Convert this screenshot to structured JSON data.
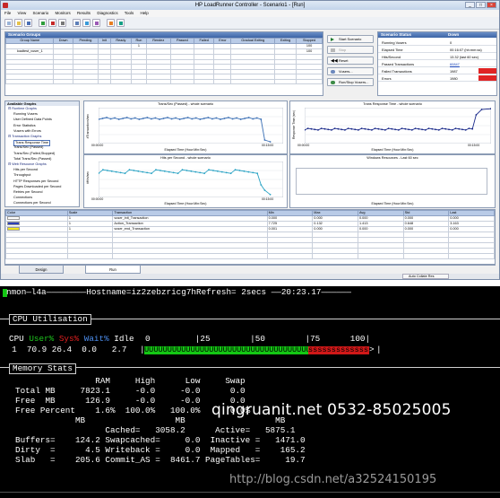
{
  "window": {
    "title": "HP LoadRunner Controller - Scenario1 - [Run]",
    "menu": [
      "File",
      "View",
      "Scenario",
      "Monitors",
      "Results",
      "Diagnostics",
      "Tools",
      "Help"
    ]
  },
  "scenario_groups": {
    "title": "Scenario Groups",
    "headers": [
      "Group Name",
      "Down",
      "Pending",
      "Init",
      "Ready",
      "Run",
      "Rendez",
      "Passed",
      "Failed",
      "Error",
      "Gradual Exiting",
      "Exiting",
      "Stopped"
    ],
    "rows": [
      [
        "",
        "",
        "",
        "",
        "",
        "1",
        "",
        "",
        "",
        "",
        "",
        "",
        "100"
      ],
      [
        "loadtest_vuser_1",
        "",
        "",
        "",
        "",
        "",
        "",
        "",
        "",
        "",
        "",
        "",
        "100"
      ]
    ]
  },
  "controls": {
    "start": "Start Scenario",
    "stop": "Stop",
    "reset": "Reset",
    "vusers": "Vusers...",
    "run_stop": "Run/Stop Vusers..."
  },
  "scenario_status": {
    "title": "Scenario Status",
    "state": "Down",
    "rows": [
      {
        "label": "Running Vusers",
        "value": "0"
      },
      {
        "label": "Elapsed Time",
        "value": "00:16:07 (hh:mm:ss)"
      },
      {
        "label": "Hits/Second",
        "value": "13.32 (last 60 sec)"
      },
      {
        "label": "Passed Transactions",
        "value": "60847"
      },
      {
        "label": "Failed Transactions",
        "value": "1987"
      },
      {
        "label": "Errors",
        "value": "1980"
      }
    ]
  },
  "available_graphs": {
    "title": "Available Graphs",
    "items": [
      "Runtime Graphs",
      "Running Vusers",
      "User Defined Data Points",
      "Error Statistics",
      "Vusers with Errors",
      "Transaction Graphs",
      "Trans Response Time",
      "Trans/Sec (Passed)",
      "Trans/Sec (Failed,Stopped)",
      "Total Trans/Sec (Passed)",
      "Web Resource Graphs",
      "Hits per Second",
      "Throughput",
      "HTTP Responses per Second",
      "Pages Downloaded per Second",
      "Retries per Second",
      "Connections",
      "Connections per Second"
    ]
  },
  "graphs": {
    "tps": {
      "title": "Trans/Sec (Passed) - whole scenario",
      "xlabel": "Elapsed Time (Hour:Min:Sec)",
      "ylabel": "#Transactions/sec",
      "ticks": [
        "00:00:00",
        "00:15:00"
      ]
    },
    "trt": {
      "title": "Trans Response Time - whole scenario",
      "xlabel": "Elapsed Time (Hour:Min:Sec)",
      "ylabel": "Response Time (sec)",
      "ticks": [
        "00:00:00",
        "00:15:00"
      ]
    },
    "hps": {
      "title": "Hits per Second - whole scenario",
      "xlabel": "Elapsed Time (Hour:Min:Sec)",
      "ylabel": "#Hits/sec",
      "ticks": [
        "00:00:00",
        "00:15:00"
      ]
    },
    "win": {
      "title": "Windows Resources - Last 60 sec",
      "xlabel": "Elapsed Time (Hour:Min:Sec)"
    }
  },
  "legend": {
    "headers": [
      "Color",
      "Scale",
      "Transaction",
      "Min",
      "Max",
      "Avg",
      "Std",
      "Last"
    ],
    "rows": [
      {
        "color": "#ffffff",
        "scale": "1",
        "name": "vuser_init_Transaction",
        "min": "0.000",
        "max": "0.000",
        "avg": "0.000",
        "std": "0.000",
        "last": "0.000"
      },
      {
        "color": "#2a3fb8",
        "scale": "1",
        "name": "Action_Transaction",
        "min": "7.725",
        "max": "0.132",
        "avg": "1.413",
        "std": "0.648",
        "last": "3.163"
      },
      {
        "color": "#f2e61a",
        "scale": "1",
        "name": "vuser_end_Transaction",
        "min": "0.001",
        "max": "0.000",
        "avg": "0.000",
        "std": "0.000",
        "last": "0.000"
      }
    ]
  },
  "tabs": [
    "Design",
    "Run"
  ],
  "status": {
    "auto_collate": "Auto Collate Res"
  },
  "nmon": {
    "header": "nmon—l4a————————Hostname=iz2zebzricg7hRefresh= 2secs ——20:23.17——————",
    "cpu_title": "CPU Utilisation",
    "cpu_header": "CPU User%  Sys% Wait% Idle",
    "cpu_user": "User%",
    "cpu_sys": "Sys%",
    "cpu_wait": "Wait%",
    "cpu_idle": "Idle",
    "cpu_scale": "0         |25        |50        |75      100|",
    "cpu_row": "  1  70.9 26.4  0.0   2.7",
    "cpu_bar_user": "UUUUUUUUUUUUUUUUUUUUUUUUUUUUUUUUUUUUUUUUUU",
    "cpu_bar_sys": "sssssssssssssss",
    "cpu_bar_end": ">",
    "cpu_user_pct": 70.9,
    "cpu_sys_pct": 26.4,
    "mem_title": "Memory Stats",
    "mem_lines": [
      "                RAM     High      Low     Swap",
      "Total MB     7823.1     -0.0     -0.0      0.0",
      "Free  MB      126.9     -0.0     -0.0      0.0",
      "Free Percent    1.6%  100.0%   100.0%      0.0%",
      "            MB                  MB                  MB",
      "                  Cached=   3058.2      Active=   5875.1",
      "Buffers=    124.2 Swapcached=     0.0  Inactive =   1471.0",
      "Dirty  =      4.5 Writeback =     0.0  Mapped   =    165.2",
      "Slab   =    205.6 Commit_AS =  8461.7 PageTables=     19.7"
    ],
    "watermark": "qingruanit.net 0532-85025005",
    "watermark2": "http://blog.csdn.net/a32524150195"
  }
}
